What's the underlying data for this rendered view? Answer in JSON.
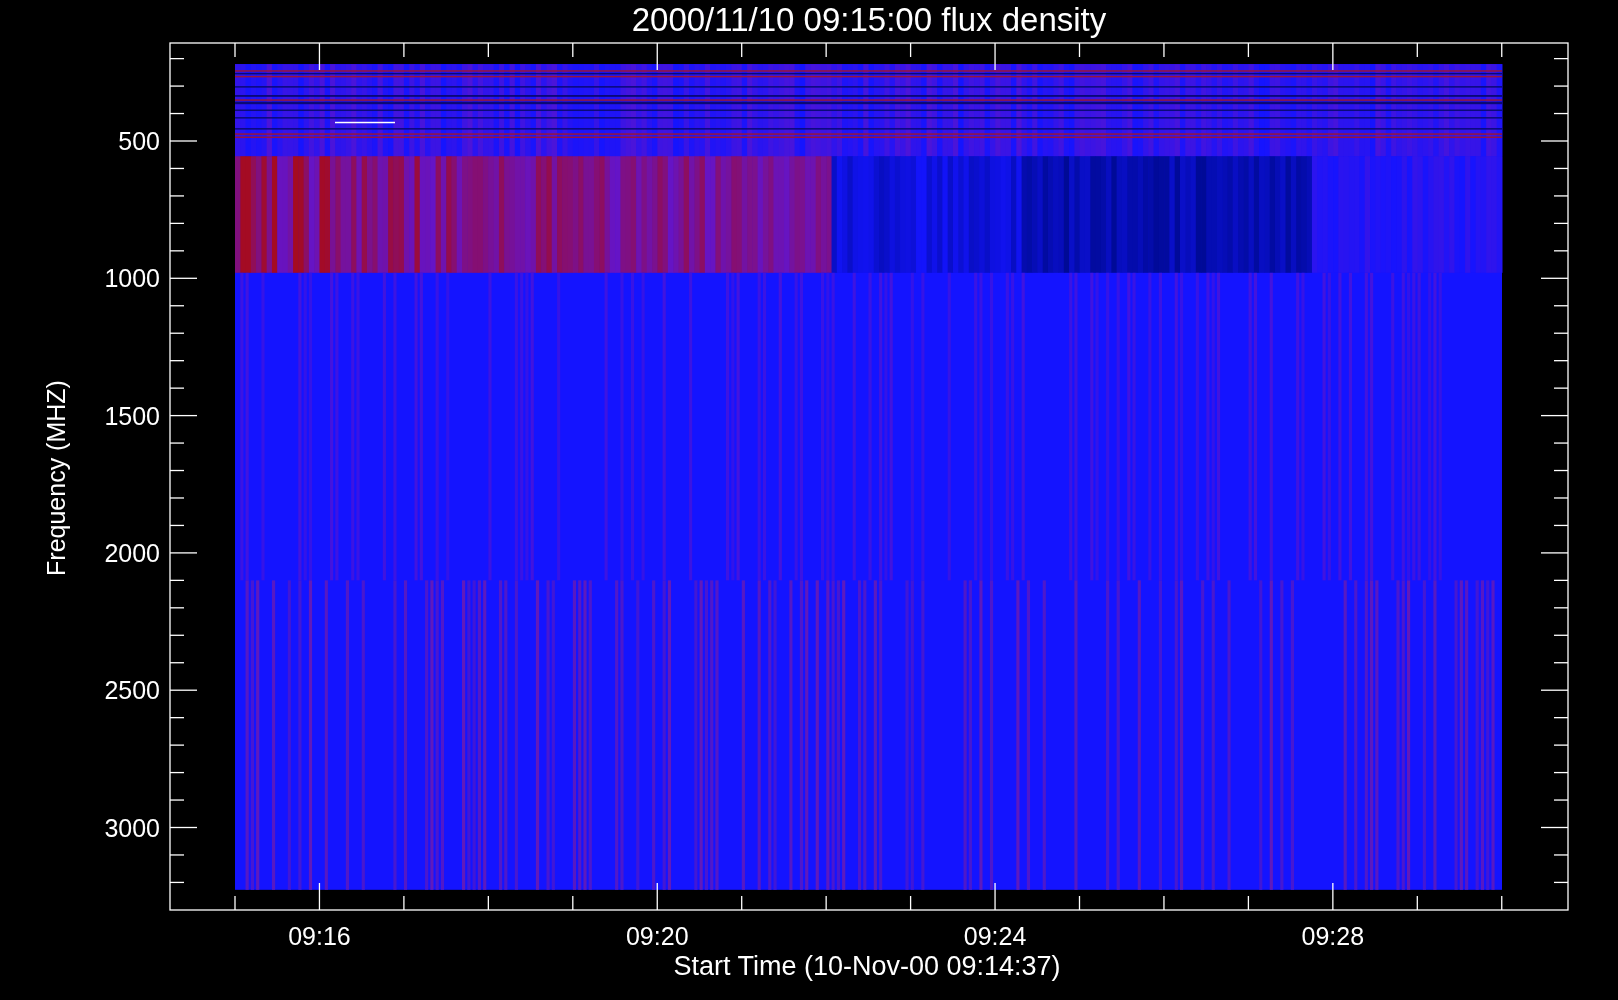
{
  "plot": {
    "title": "2000/11/10 09:15:00 flux density",
    "xlabel": "Start Time (10-Nov-00 09:14:37)",
    "ylabel": "Frequency (MHZ)",
    "x_tick_labels": [
      "09:16",
      "09:20",
      "09:24",
      "09:28"
    ],
    "y_tick_labels": [
      "500",
      "1000",
      "1500",
      "2000",
      "2500",
      "3000"
    ]
  }
}
